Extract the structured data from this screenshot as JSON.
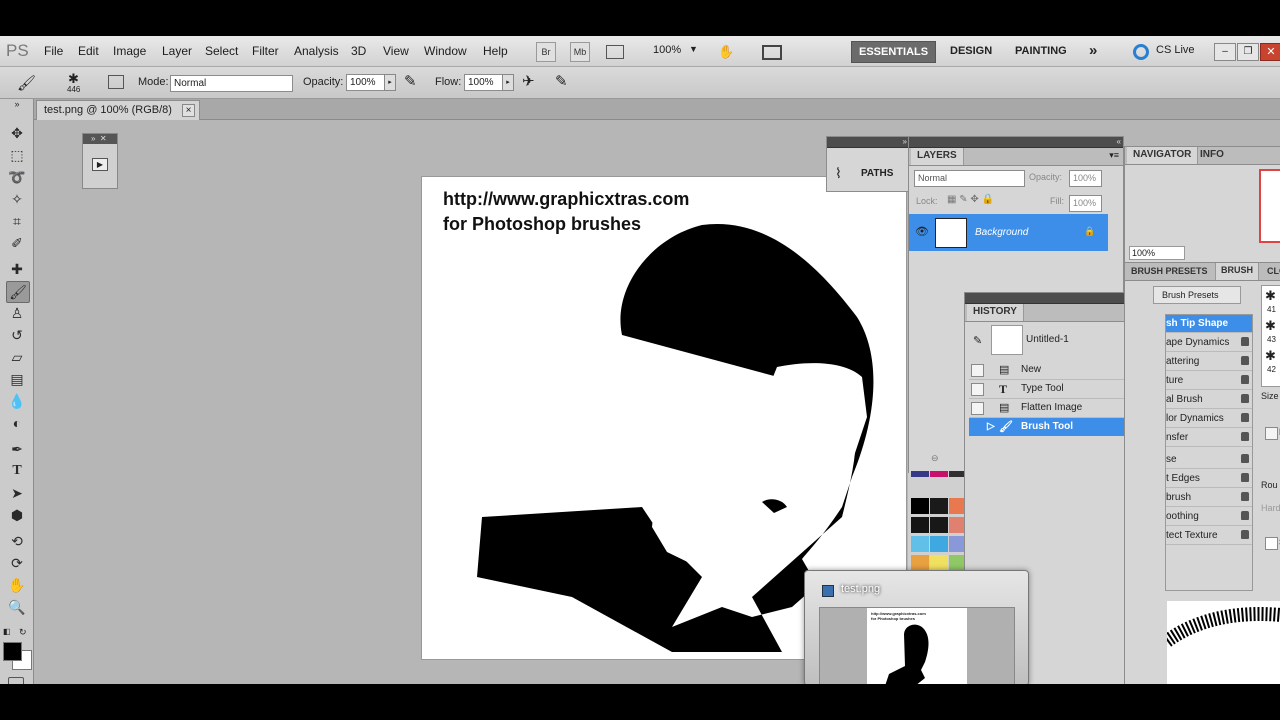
{
  "app": {
    "logo": "PS"
  },
  "menu": {
    "items": [
      "File",
      "Edit",
      "Image",
      "Layer",
      "Select",
      "Filter",
      "Analysis",
      "3D",
      "View",
      "Window",
      "Help"
    ]
  },
  "appbar": {
    "br": "Br",
    "mb": "Mb",
    "zoom": "100%",
    "workspaces": [
      "ESSENTIALS",
      "DESIGN",
      "PAINTING"
    ],
    "more": "»",
    "cslive": "CS Live"
  },
  "options": {
    "brush_size": "446",
    "mode_label": "Mode:",
    "mode_value": "Normal",
    "opacity_label": "Opacity:",
    "opacity_value": "100%",
    "flow_label": "Flow:",
    "flow_value": "100%"
  },
  "document": {
    "tab_title": "test.png @ 100% (RGB/8)",
    "close": "×"
  },
  "canvas": {
    "line1": "http://www.graphicxtras.com",
    "line2": "for Photoshop brushes"
  },
  "paths_panel": {
    "label": "PATHS"
  },
  "layers_panel": {
    "tab": "LAYERS",
    "blend_mode": "Normal",
    "opacity_label": "Opacity:",
    "opacity_value": "100%",
    "lock_label": "Lock:",
    "fill_label": "Fill:",
    "fill_value": "100%",
    "layer_name": "Background"
  },
  "history_panel": {
    "tab": "HISTORY",
    "snapshot": "Untitled-1",
    "items": [
      "New",
      "Type Tool",
      "Flatten Image",
      "Brush Tool"
    ]
  },
  "navigator_panel": {
    "tabs": [
      "NAVIGATOR",
      "INFO"
    ],
    "zoom": "100%"
  },
  "brush_panel": {
    "tabs": [
      "BRUSH PRESETS",
      "BRUSH",
      "CLO"
    ],
    "presets_button": "Brush Presets",
    "items": [
      "sh Tip Shape",
      "ape Dynamics",
      "attering",
      "ture",
      "al Brush",
      "lor Dynamics",
      "nsfer",
      "se",
      "t Edges",
      "brush",
      "oothing",
      "tect Texture"
    ],
    "sizes": [
      "41",
      "43",
      "42"
    ],
    "size_label": "Size",
    "right_labels": [
      "F",
      "Rou",
      "Hard",
      "S"
    ]
  },
  "thumbnail": {
    "title": "test.png",
    "line1": "http://www.graphicxtras.com",
    "line2": "for Photoshop brushes"
  },
  "swatches": [
    "#383888",
    "#c8106a",
    "#303030",
    "#000000",
    "#1a1a1a",
    "#e87850",
    "#141414",
    "#181818",
    "#e08070",
    "#60c0e8",
    "#40a8e0",
    "#8898d8",
    "#e8a040",
    "#f0e060",
    "#90c868",
    "#8060a8",
    "#a060a0",
    "#e860a0"
  ],
  "toolbox": {
    "fg_color": "#000000",
    "bg_color": "#ffffff"
  }
}
